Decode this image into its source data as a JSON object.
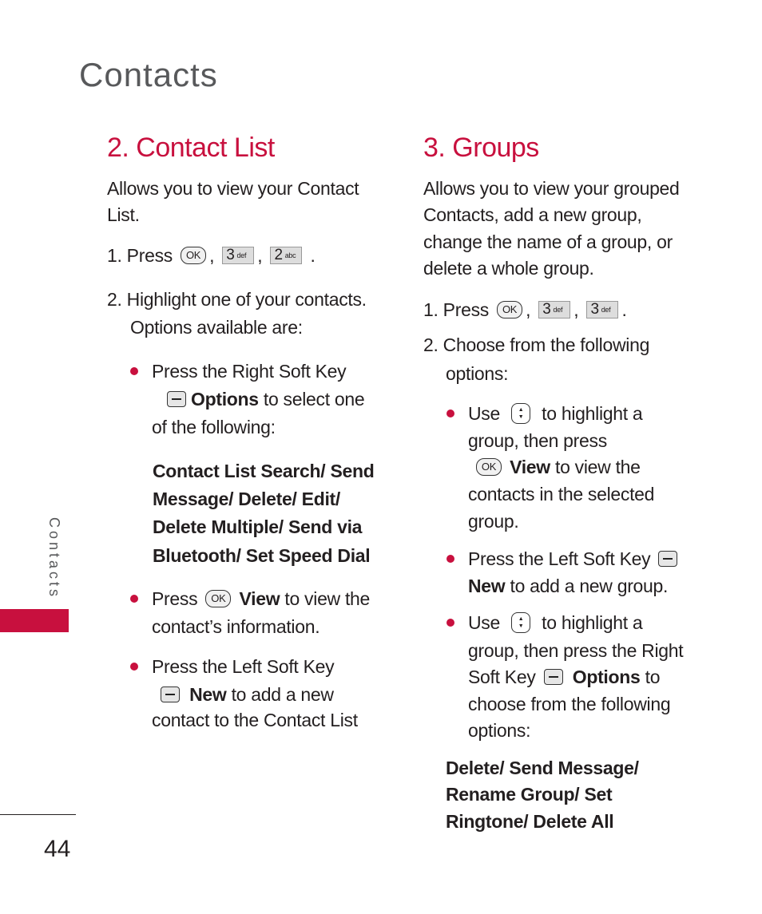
{
  "page_title": "Contacts",
  "side_tab": "Contacts",
  "page_number": "44",
  "accent_color": "#c8103e",
  "left": {
    "heading": "2. Contact List",
    "lines": [
      [
        "Allows you to view your Contact"
      ],
      [
        "List."
      ],
      [
        "1. Press ",
        {
          "icon": "ok-key"
        },
        ", ",
        {
          "icon": "key",
          "label": "3",
          "sub": "def"
        },
        ", ",
        {
          "icon": "key",
          "label": "2",
          "sub": "abc"
        },
        " ."
      ],
      [
        "2. Highlight one of your contacts."
      ],
      [
        "Options available are:"
      ],
      [
        {
          "bullet": true
        },
        "Press the Right Soft Key"
      ],
      [
        {
          "icon": "soft-key"
        },
        {
          "b": "Options"
        },
        " to select one"
      ],
      [
        "of the following:"
      ],
      [
        {
          "b": "Contact List Search/ Send"
        }
      ],
      [
        {
          "b": "Message/ Delete/ Edit/"
        }
      ],
      [
        {
          "b": "Delete Multiple/ Send via"
        }
      ],
      [
        {
          "b": "Bluetooth/ Set Speed Dial"
        }
      ],
      [
        {
          "bullet": true
        },
        "Press ",
        {
          "icon": "ok-key"
        },
        " ",
        {
          "b": "View"
        },
        " to view the"
      ],
      [
        "contact’s information."
      ],
      [
        {
          "bullet": true
        },
        "Press the Left Soft Key"
      ],
      [
        {
          "icon": "soft-key"
        },
        " ",
        {
          "b": "New"
        },
        " to add a new"
      ],
      [
        "contact to the Contact List"
      ]
    ]
  },
  "right": {
    "heading": "3. Groups",
    "lines": [
      [
        "Allows you to view your grouped"
      ],
      [
        "Contacts, add a new group,"
      ],
      [
        "change the name of a group, or"
      ],
      [
        "delete a whole group."
      ],
      [
        "1. Press ",
        {
          "icon": "ok-key"
        },
        ", ",
        {
          "icon": "key",
          "label": "3",
          "sub": "def"
        },
        ", ",
        {
          "icon": "key",
          "label": "3",
          "sub": "def"
        },
        "."
      ],
      [
        "2. Choose from the following"
      ],
      [
        "options:"
      ],
      [
        {
          "bullet": true
        },
        "Use ",
        {
          "icon": "nav-key"
        },
        " to highlight a"
      ],
      [
        "group, then press"
      ],
      [
        {
          "icon": "ok-key"
        },
        " ",
        {
          "b": "View"
        },
        " to view the"
      ],
      [
        "contacts in the selected"
      ],
      [
        "group."
      ],
      [
        {
          "bullet": true
        },
        "Press the Left Soft Key ",
        {
          "icon": "soft-key"
        }
      ],
      [
        {
          "b": "New"
        },
        " to add a new group."
      ],
      [
        {
          "bullet": true
        },
        "Use ",
        {
          "icon": "nav-key"
        },
        " to highlight a"
      ],
      [
        "group, then press the Right"
      ],
      [
        "Soft Key ",
        {
          "icon": "soft-key"
        },
        " ",
        {
          "b": "Options"
        },
        " to"
      ],
      [
        "choose from the following"
      ],
      [
        "options:"
      ],
      [
        {
          "b": "Delete/ Send Message/"
        }
      ],
      [
        {
          "b": "Rename Group/ Set"
        }
      ],
      [
        {
          "b": "Ringtone/ Delete All"
        }
      ]
    ]
  }
}
